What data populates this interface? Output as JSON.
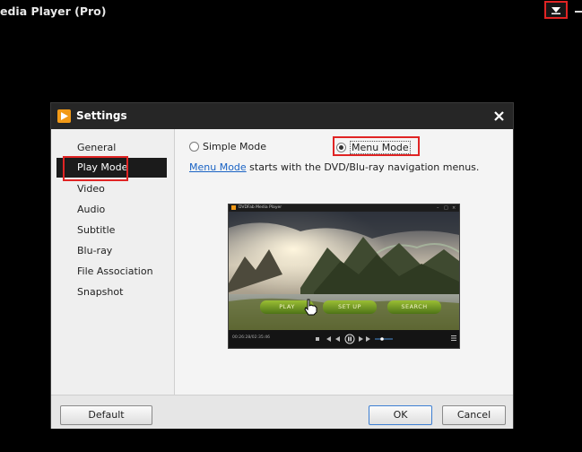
{
  "app": {
    "title": "edia Player (Pro)"
  },
  "dialog": {
    "title": "Settings",
    "nav": [
      {
        "label": "General",
        "active": false
      },
      {
        "label": "Play Mode",
        "active": true
      },
      {
        "label": "Video",
        "active": false
      },
      {
        "label": "Audio",
        "active": false
      },
      {
        "label": "Subtitle",
        "active": false
      },
      {
        "label": "Blu-ray",
        "active": false
      },
      {
        "label": "File Association",
        "active": false
      },
      {
        "label": "Snapshot",
        "active": false
      }
    ],
    "modes": {
      "simple_label": "Simple Mode",
      "simple_selected": false,
      "menu_label": "Menu Mode",
      "menu_selected": true
    },
    "description": {
      "link": "Menu Mode",
      "text": " starts with the DVD/Blu-ray navigation menus."
    },
    "preview": {
      "window_title": "DVDFab Media Player",
      "buttons": [
        "PLAY",
        "SET UP",
        "SEARCH"
      ],
      "time": "00:26:28/02:35:46"
    },
    "buttons": {
      "default": "Default",
      "ok": "OK",
      "cancel": "Cancel"
    }
  },
  "colors": {
    "accent": "#f29a17",
    "highlight": "#e02424",
    "link": "#1a63c4"
  },
  "icons": {
    "menu_toggle": "triangle-down-icon",
    "close": "close-icon",
    "logo": "play-logo-icon",
    "cursor": "hand-cursor-icon"
  }
}
